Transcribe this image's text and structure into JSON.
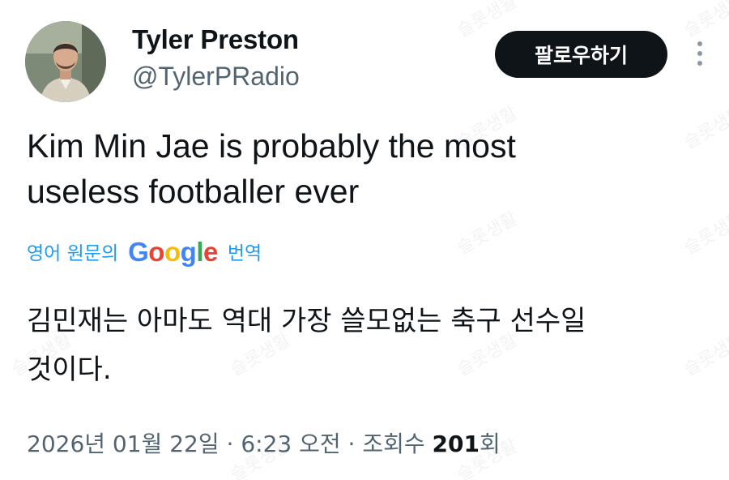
{
  "author": {
    "display_name": "Tyler Preston",
    "handle": "@TylerPRadio"
  },
  "actions": {
    "follow_label": "팔로우하기",
    "more_icon": "more-vertical-icon"
  },
  "tweet": {
    "text": "Kim Min Jae is probably the most\nuseless footballer ever",
    "translate_prefix": "영어 원문의",
    "translate_suffix": "번역",
    "google_logo_letters": [
      "G",
      "o",
      "o",
      "g",
      "l",
      "e"
    ],
    "translated_text": "김민재는 아마도 역대 가장 쓸모없는 축구 선수일\n것이다."
  },
  "meta": {
    "date": "2026년 01월 22일",
    "separator": "·",
    "time": "6:23 오전",
    "views_label": "조회수",
    "views_count": "201",
    "views_suffix": "회"
  },
  "watermark": "슬롯생활",
  "colors": {
    "link": "#1d9bf0",
    "text": "#0f1419",
    "secondary": "#536471",
    "button_bg": "#0f1419"
  }
}
